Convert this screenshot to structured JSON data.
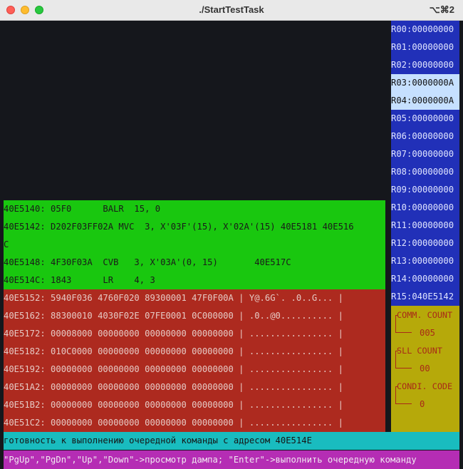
{
  "window": {
    "title": "./StartTestTask",
    "shortcut": "⌥⌘2"
  },
  "instructions": [
    {
      "text": "40E5140: 05F0      BALR  15, 0"
    },
    {
      "text": "40E5142: D202F03FF02A MVC  3, X'03F'(15), X'02A'(15) 40E5181 40E516"
    },
    {
      "text": "C"
    },
    {
      "text": "40E5148: 4F30F03A  CVB   3, X'03A'(0, 15)       40E517C"
    },
    {
      "text": "40E514C: 1843      LR    4, 3"
    }
  ],
  "dump": [
    {
      "text": "40E5152: 5940F036 4760F020 89300001 47F0F00A | Y@.6G`. .0..G... |"
    },
    {
      "text": "40E5162: 88300010 4030F02E 07FE0001 0C000000 | .0..@0.......... |"
    },
    {
      "text": "40E5172: 00008000 00000000 00000000 00000000 | ................ |"
    },
    {
      "text": "40E5182: 010C0000 00000000 00000000 00000000 | ................ |"
    },
    {
      "text": "40E5192: 00000000 00000000 00000000 00000000 | ................ |"
    },
    {
      "text": "40E51A2: 00000000 00000000 00000000 00000000 | ................ |"
    },
    {
      "text": "40E51B2: 00000000 00000000 00000000 00000000 | ................ |"
    },
    {
      "text": "40E51C2: 00000000 00000000 00000000 00000000 | ................ |"
    }
  ],
  "registers": [
    {
      "text": "R00:00000000",
      "highlighted": false
    },
    {
      "text": "R01:00000000",
      "highlighted": false
    },
    {
      "text": "R02:00000000",
      "highlighted": false
    },
    {
      "text": "R03:0000000A",
      "highlighted": true
    },
    {
      "text": "R04:0000000A",
      "highlighted": true
    },
    {
      "text": "R05:00000000",
      "highlighted": false
    },
    {
      "text": "R06:00000000",
      "highlighted": false
    },
    {
      "text": "R07:00000000",
      "highlighted": false
    },
    {
      "text": "R08:00000000",
      "highlighted": false
    },
    {
      "text": "R09:00000000",
      "highlighted": false
    },
    {
      "text": "R10:00000000",
      "highlighted": false
    },
    {
      "text": "R11:00000000",
      "highlighted": false
    },
    {
      "text": "R12:00000000",
      "highlighted": false
    },
    {
      "text": "R13:00000000",
      "highlighted": false
    },
    {
      "text": "R14:00000000",
      "highlighted": false
    },
    {
      "text": "R15:040E5142",
      "highlighted": false
    }
  ],
  "flags": {
    "comm_count_label": "COMM. COUNT",
    "comm_count_value": "005",
    "sll_count_label": "SLL COUNT",
    "sll_count_value": "00",
    "condi_code_label": "CONDI. CODE",
    "condi_code_value": "0"
  },
  "status": "готовность к выполнению очередной команды с адресом 40E514E",
  "hint": "\"PgUp\",\"PgDn\",\"Up\",\"Down\"->просмотр дампа; \"Enter\"->выполнить очередную команду",
  "colors": {
    "background": "#15171c",
    "instructions_panel": "#19c70f",
    "dump_panel": "#ad2a1f",
    "registers_panel": "#2130b8",
    "register_highlight": "#c6e0ff",
    "flags_panel": "#b6a90a",
    "status_bar": "#19bcbf",
    "hint_bar": "#b52db4"
  }
}
